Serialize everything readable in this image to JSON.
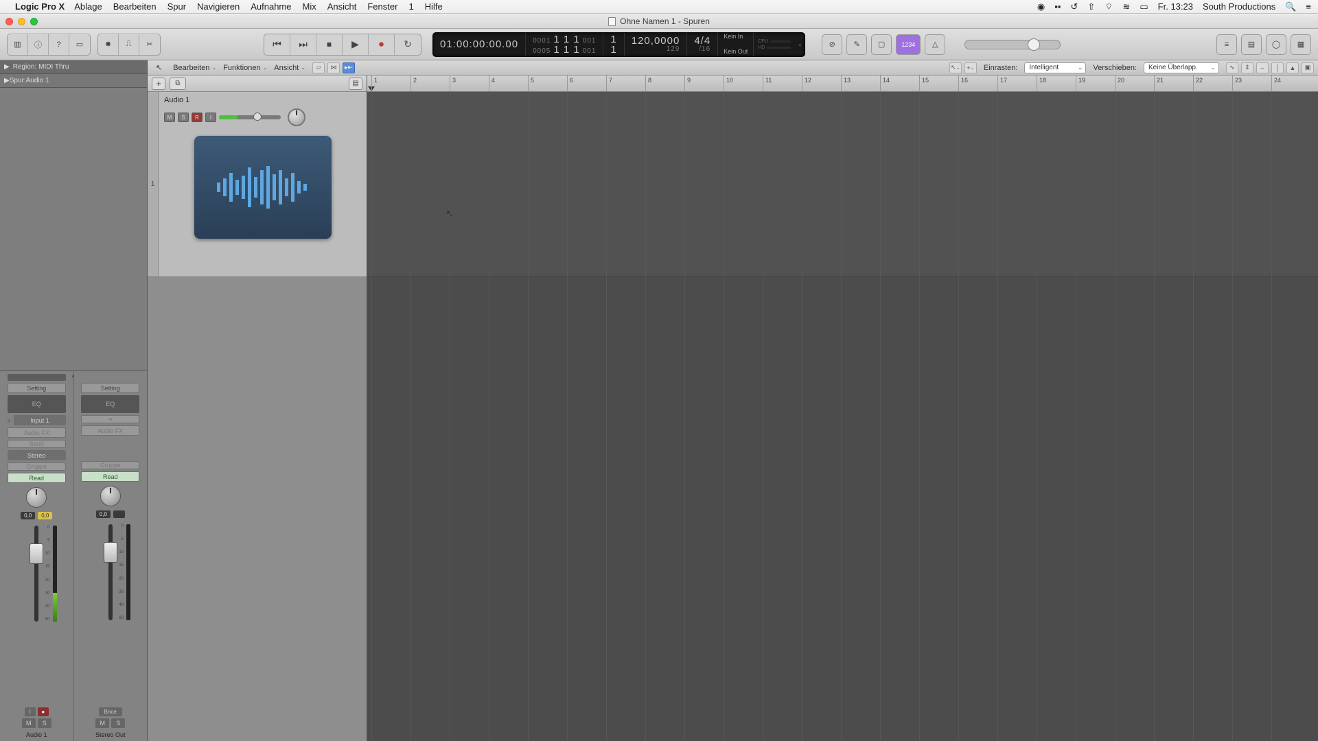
{
  "menubar": {
    "app": "Logic Pro X",
    "items": [
      "Ablage",
      "Bearbeiten",
      "Spur",
      "Navigieren",
      "Aufnahme",
      "Mix",
      "Ansicht",
      "Fenster",
      "1",
      "Hilfe"
    ],
    "clock": "Fr. 13:23",
    "user": "South Productions"
  },
  "window": {
    "title": "Ohne Namen 1 - Spuren"
  },
  "lcd": {
    "smpte_top": "01:00:00:00.00",
    "smpte_bot": "    ",
    "pos_top": "1  1  1",
    "pos_bot": "1  1  1",
    "beat_top": "1",
    "beat_bot": "1",
    "left_small_top": "0001",
    "left_small_bot": "0005",
    "right_small_top": "001",
    "right_small_bot": "001",
    "tempo_top": "120,0000",
    "tempo_bot": "129",
    "sig_top": "4/4",
    "sig_bot": "/16",
    "sync_in": "Kein In",
    "sync_out": "Kein Out",
    "cpu": "CPU",
    "hd": "HD"
  },
  "count_btn": "1234",
  "inspector": {
    "region_lbl": "Region:",
    "region_val": "MIDI Thru",
    "track_lbl": "Spur:",
    "track_val": "Audio 1"
  },
  "strip1": {
    "setting": "Setting",
    "eq": "EQ",
    "input": "Input 1",
    "input_ring": "○",
    "audiofx": "Audio FX",
    "send": "Send",
    "stereo": "Stereo",
    "gruppe": "Gruppe",
    "read": "Read",
    "db1": "0,0",
    "db2": "0,0",
    "rec": "●",
    "i": "I",
    "m": "M",
    "s": "S",
    "name": "Audio 1"
  },
  "strip2": {
    "setting": "Setting",
    "eq": "EQ",
    "link": "⚭",
    "audiofx": "Audio FX",
    "gruppe": "Gruppe",
    "read": "Read",
    "db1": "0,0",
    "bnce": "Bnce",
    "m": "M",
    "s": "S",
    "name": "Stereo Out"
  },
  "tracktb": {
    "edit": "Bearbeiten",
    "func": "Funktionen",
    "view": "Ansicht",
    "snap_lbl": "Einrasten:",
    "snap_val": "Intelligent",
    "drag_lbl": "Verschieben:",
    "drag_val": "Keine Überlapp."
  },
  "track1": {
    "name": "Audio 1",
    "m": "M",
    "s": "S",
    "r": "R",
    "i": "I"
  },
  "ruler": {
    "bars": [
      1,
      2,
      3,
      4,
      5,
      6,
      7,
      8,
      9,
      10,
      11,
      12,
      13,
      14,
      15,
      16,
      17,
      18,
      19,
      20,
      21,
      22,
      23,
      24
    ]
  },
  "fader_ticks": [
    "0",
    "5",
    "10",
    "15",
    "20",
    "30",
    "40",
    "60"
  ]
}
